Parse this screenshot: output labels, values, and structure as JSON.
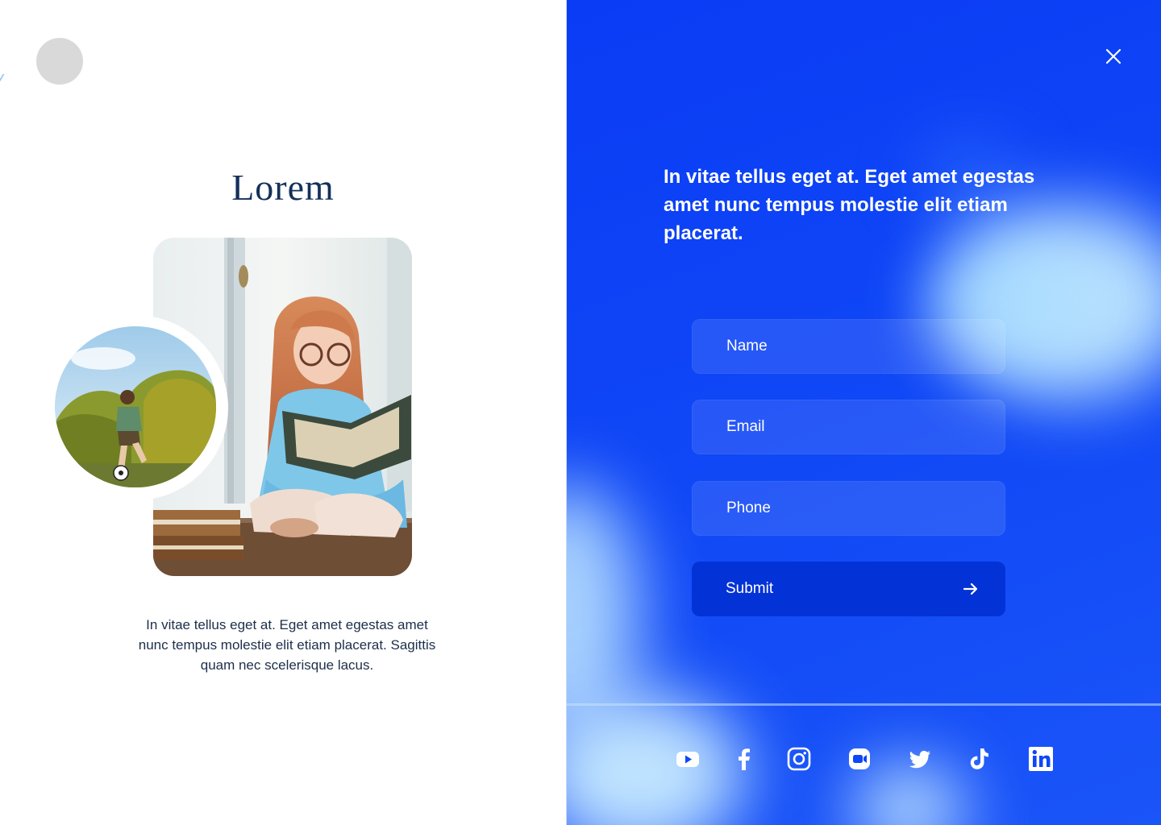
{
  "brand": {
    "name": "Lorem"
  },
  "left": {
    "description": "In vitae tellus eget at. Eget amet egestas amet nunc tempus molestie elit etiam placerat. Sagittis quam nec scelerisque lacus."
  },
  "right": {
    "heading": "In vitae tellus eget at. Eget amet egestas amet nunc tempus molestie elit etiam placerat.",
    "form": {
      "name_placeholder": "Name",
      "email_placeholder": "Email",
      "phone_placeholder": "Phone",
      "submit_label": "Submit"
    },
    "close_icon": "close-icon",
    "socials": [
      "youtube-icon",
      "facebook-icon",
      "instagram-icon",
      "zoom-icon",
      "twitter-icon",
      "tiktok-icon",
      "linkedin-icon"
    ]
  },
  "colors": {
    "brand_blue": "#0a3cf5",
    "submit_blue": "#0332d6",
    "text_dark": "#1c2f4a",
    "logo_placeholder": "#d9d9d9"
  }
}
